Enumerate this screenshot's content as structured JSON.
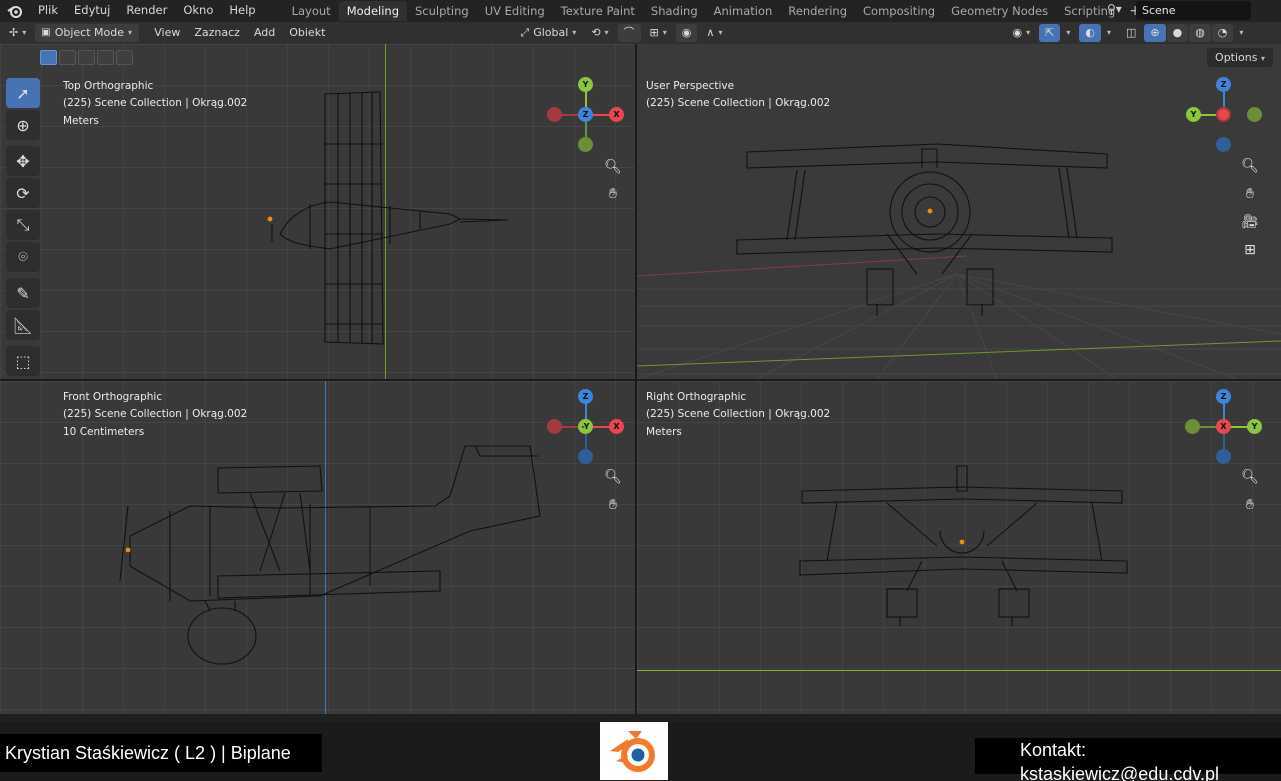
{
  "menubar": {
    "items": [
      "Plik",
      "Edytuj",
      "Render",
      "Okno",
      "Help"
    ],
    "workspaces": [
      "Layout",
      "Modeling",
      "Sculpting",
      "UV Editing",
      "Texture Paint",
      "Shading",
      "Animation",
      "Rendering",
      "Compositing",
      "Geometry Nodes",
      "Scripting"
    ],
    "active_workspace": "Modeling",
    "scene": "Scene"
  },
  "toolbar": {
    "mode": "Object Mode",
    "menus": [
      "View",
      "Zaznacz",
      "Add",
      "Obiekt"
    ],
    "orientation": "Global",
    "options_label": "Options"
  },
  "viewports": {
    "top": {
      "title": "Top Orthographic",
      "collection": "(225) Scene Collection | Okrąg.002",
      "units": "Meters"
    },
    "user": {
      "title": "User Perspective",
      "collection": "(225) Scene Collection | Okrąg.002"
    },
    "front": {
      "title": "Front Orthographic",
      "collection": "(225) Scene Collection | Okrąg.002",
      "units": "10 Centimeters"
    },
    "right": {
      "title": "Right Orthographic",
      "collection": "(225) Scene Collection | Okrąg.002",
      "units": "Meters"
    }
  },
  "gizmo_labels": {
    "top": {
      "up": "Y",
      "center": "Z",
      "right": "X"
    },
    "user": {
      "up": "Z",
      "left": "Y"
    },
    "front": {
      "up": "Z",
      "center": "-Y",
      "right": "X"
    },
    "right": {
      "up": "Z",
      "center": "X",
      "right": "Y"
    }
  },
  "axis_colors": {
    "x": "#e8474f",
    "y": "#8cc63f",
    "z": "#3d85d9"
  },
  "footer": {
    "author": "Krystian Staśkiewicz ( L2 ) | Biplane",
    "contact": "Kontakt: kstaskiewicz@edu.cdv.pl"
  }
}
